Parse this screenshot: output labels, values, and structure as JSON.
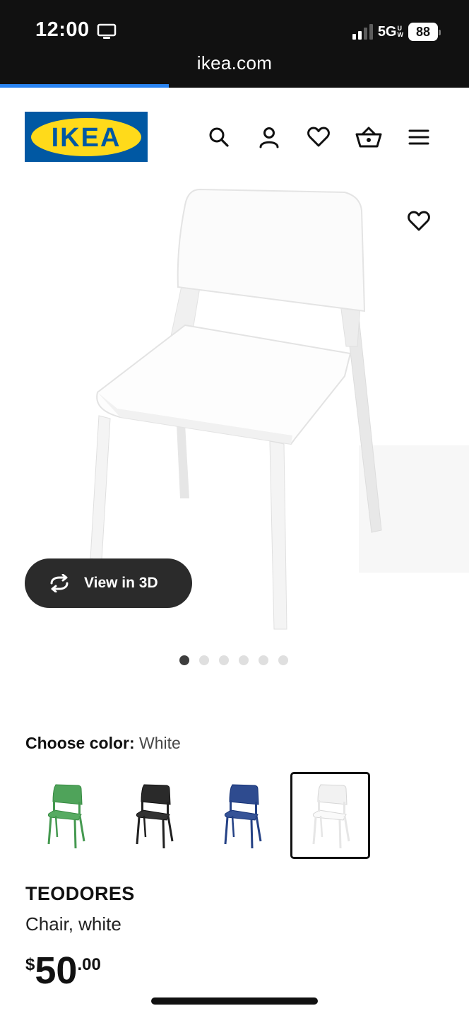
{
  "status_bar": {
    "time": "12:00",
    "network": "5G",
    "network_sub": [
      "U",
      "W"
    ],
    "battery": "88"
  },
  "browser": {
    "url": "ikea.com",
    "load_progress": 0.36,
    "progress_color": "#2a84f2"
  },
  "header": {
    "logo_text": "IKEA",
    "brand_blue": "#0058a3",
    "brand_yellow": "#ffda1a",
    "icons": [
      "search-icon",
      "account-icon",
      "heart-icon",
      "basket-icon",
      "menu-icon"
    ]
  },
  "gallery": {
    "view_3d_label": "View in 3D",
    "image_count": 6,
    "active_index": 0
  },
  "color_picker": {
    "label": "Choose color:",
    "selected": "White",
    "options": [
      {
        "name": "Green",
        "color": "#4fa35a"
      },
      {
        "name": "Black",
        "color": "#2a2a2a"
      },
      {
        "name": "Blue",
        "color": "#2e4b8f"
      },
      {
        "name": "White",
        "color": "#f2f2f2"
      }
    ]
  },
  "product": {
    "name": "TEODORES",
    "description": "Chair, white",
    "price_currency": "$",
    "price_integer": "50",
    "price_decimal": ".00"
  }
}
